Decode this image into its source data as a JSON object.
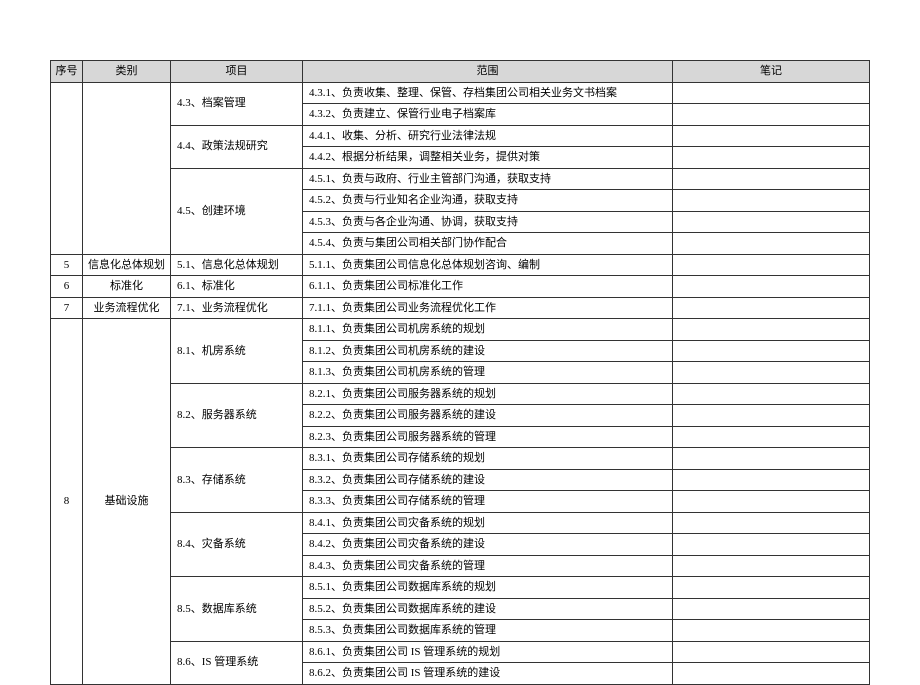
{
  "headers": {
    "seq": "序号",
    "category": "类别",
    "project": "项目",
    "scope": "范围",
    "notes": "笔记"
  },
  "groups": [
    {
      "seq": "",
      "category": "",
      "projects": [
        {
          "label": "4.3、档案管理",
          "items": [
            "4.3.1、负责收集、整理、保管、存档集团公司相关业务文书档案",
            "4.3.2、负责建立、保管行业电子档案库"
          ]
        },
        {
          "label": "4.4、政策法规研究",
          "items": [
            "4.4.1、收集、分析、研究行业法律法规",
            "4.4.2、根据分析结果，调整相关业务，提供对策"
          ]
        },
        {
          "label": "4.5、创建环境",
          "items": [
            "4.5.1、负责与政府、行业主管部门沟通，获取支持",
            "4.5.2、负责与行业知名企业沟通，获取支持",
            "4.5.3、负责与各企业沟通、协调，获取支持",
            "4.5.4、负责与集团公司相关部门协作配合"
          ]
        }
      ]
    },
    {
      "seq": "5",
      "category": "信息化总体规划",
      "projects": [
        {
          "label": "5.1、信息化总体规划",
          "items": [
            "5.1.1、负责集团公司信息化总体规划咨询、编制"
          ]
        }
      ]
    },
    {
      "seq": "6",
      "category": "标准化",
      "projects": [
        {
          "label": "6.1、标准化",
          "items": [
            "6.1.1、负责集团公司标准化工作"
          ]
        }
      ]
    },
    {
      "seq": "7",
      "category": "业务流程优化",
      "projects": [
        {
          "label": "7.1、业务流程优化",
          "items": [
            "7.1.1、负责集团公司业务流程优化工作"
          ]
        }
      ]
    },
    {
      "seq": "8",
      "category": "基础设施",
      "projects": [
        {
          "label": "8.1、机房系统",
          "items": [
            "8.1.1、负责集团公司机房系统的规划",
            "8.1.2、负责集团公司机房系统的建设",
            "8.1.3、负责集团公司机房系统的管理"
          ]
        },
        {
          "label": "8.2、服务器系统",
          "items": [
            "8.2.1、负责集团公司服务器系统的规划",
            "8.2.2、负责集团公司服务器系统的建设",
            "8.2.3、负责集团公司服务器系统的管理"
          ]
        },
        {
          "label": "8.3、存储系统",
          "items": [
            "8.3.1、负责集团公司存储系统的规划",
            "8.3.2、负责集团公司存储系统的建设",
            "8.3.3、负责集团公司存储系统的管理"
          ]
        },
        {
          "label": "8.4、灾备系统",
          "items": [
            "8.4.1、负责集团公司灾备系统的规划",
            "8.4.2、负责集团公司灾备系统的建设",
            "8.4.3、负责集团公司灾备系统的管理"
          ]
        },
        {
          "label": "8.5、数据库系统",
          "items": [
            "8.5.1、负责集团公司数据库系统的规划",
            "8.5.2、负责集团公司数据库系统的建设",
            "8.5.3、负责集团公司数据库系统的管理"
          ]
        },
        {
          "label": "8.6、IS 管理系统",
          "items": [
            "8.6.1、负责集团公司 IS 管理系统的规划",
            "8.6.2、负责集团公司 IS 管理系统的建设"
          ]
        }
      ]
    }
  ]
}
